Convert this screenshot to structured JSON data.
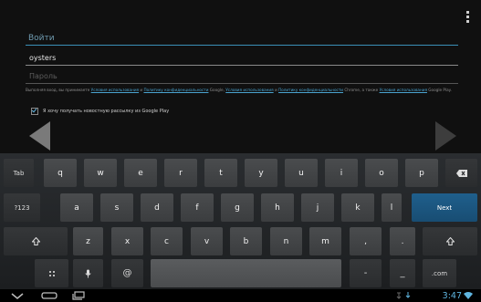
{
  "form": {
    "title": "Войти",
    "email_value": "oysters",
    "password_placeholder": "Пароль",
    "legal_prefix": "Выполняя вход, вы принимаете ",
    "legal_link_1": "Условия использования",
    "legal_and_1": " и ",
    "legal_link_2": "Политику конфиденциальности",
    "legal_mid": " Google, ",
    "legal_link_3": "Условия использования",
    "legal_and_2": " и ",
    "legal_link_4": "Политику конфиденциальности",
    "legal_mid2": " Chrome, а также ",
    "legal_link_5": "Условия использования",
    "legal_suffix": " Google Play.",
    "newsletter_label": "Я хочу получать новостную рассылку из Google Play"
  },
  "keyboard": {
    "row1": [
      "q",
      "w",
      "e",
      "r",
      "t",
      "y",
      "u",
      "i",
      "o",
      "p"
    ],
    "row2": [
      "a",
      "s",
      "d",
      "f",
      "g",
      "h",
      "j",
      "k",
      "l"
    ],
    "row3": [
      "z",
      "x",
      "c",
      "v",
      "b",
      "n",
      "m",
      ",",
      "."
    ],
    "tab_label": "Tab",
    "symbols_label": "?123",
    "next_label": "Next",
    "at_label": "@",
    "dash_label": "-",
    "underscore_label": "_",
    "com_label": ".com",
    "mic_icon": "microphone-icon",
    "settings_icon": "keyboard-settings-icon",
    "backspace_icon": "backspace-icon",
    "shift_icon": "shift-icon"
  },
  "status": {
    "time": "3:47",
    "accent_color": "#5fb5e0"
  },
  "nav": {
    "back_icon": "back-icon",
    "home_icon": "home-icon",
    "recents_icon": "recent-apps-icon"
  }
}
